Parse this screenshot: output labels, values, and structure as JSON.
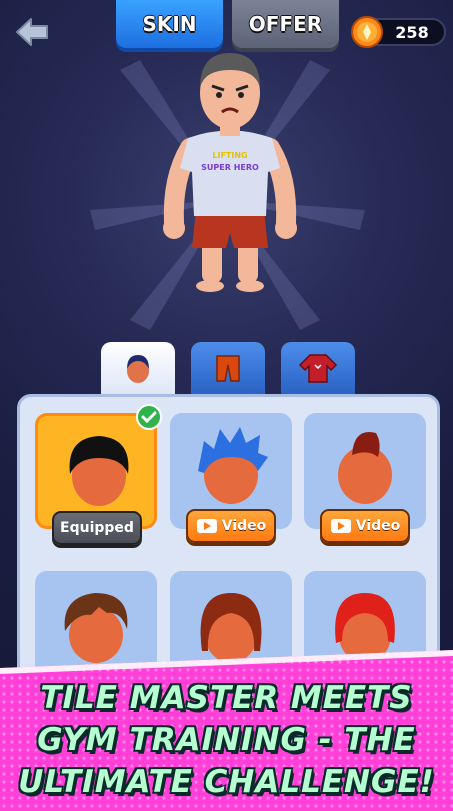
{
  "topbar": {
    "skin_tab": "SKIN",
    "offer_tab": "OFFER",
    "coins": "258"
  },
  "character": {
    "shirt_line1": "LIFTING",
    "shirt_line2": "SUPER HERO"
  },
  "categories": [
    "head",
    "pants",
    "shirt"
  ],
  "items": [
    {
      "hair": "short black",
      "status": "Equipped"
    },
    {
      "hair": "blue spiky",
      "status": "Video"
    },
    {
      "hair": "red mohawk",
      "status": "Video"
    },
    {
      "hair": "brown messy",
      "status": ""
    },
    {
      "hair": "auburn long",
      "status": ""
    },
    {
      "hair": "red bob",
      "status": ""
    }
  ],
  "banner": {
    "line1": "TILE MASTER MEETS",
    "line2": "GYM TRAINING - THE",
    "line3": "ULTIMATE CHALLENGE!"
  },
  "colors": {
    "accent": "#1e6fe0",
    "equipped_bg": "#ffb424",
    "video_btn": "#ff7a12",
    "banner_pink": "#ff3fd8",
    "banner_text": "#b6ffd0"
  }
}
